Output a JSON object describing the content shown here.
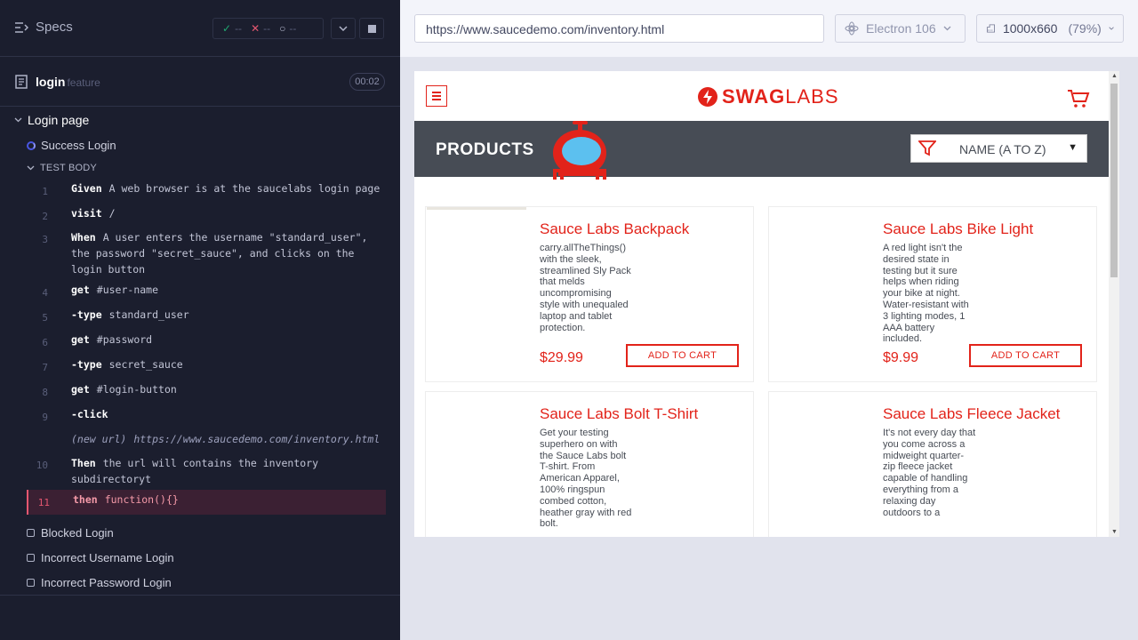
{
  "reporter": {
    "specs_label": "Specs",
    "stats": {
      "passed": "--",
      "failed": "--",
      "pending": "--"
    },
    "spec": {
      "name": "login",
      "kind": "feature",
      "duration": "00:02"
    },
    "suite": "Login page",
    "active_test": "Success Login",
    "test_body_label": "TEST BODY",
    "commands": [
      {
        "num": "1",
        "lines": 1,
        "kw": "Given",
        "arg": "A web browser is at the saucelabs login page"
      },
      {
        "num": "2",
        "lines": 1,
        "kw": "visit",
        "arg": "/"
      },
      {
        "num": "3",
        "lines": 3,
        "kw": "When",
        "arg": "A user enters the username \"standard_user\", the password \"secret_sauce\", and clicks on the login button"
      },
      {
        "num": "4",
        "lines": 1,
        "kw": "get",
        "arg": "#user-name"
      },
      {
        "num": "5",
        "lines": 1,
        "kw": "-type",
        "arg": "standard_user"
      },
      {
        "num": "6",
        "lines": 1,
        "kw": "get",
        "arg": "#password"
      },
      {
        "num": "7",
        "lines": 1,
        "kw": "-type",
        "arg": "secret_sauce"
      },
      {
        "num": "8",
        "lines": 1,
        "kw": "get",
        "arg": "#login-button"
      },
      {
        "num": "9",
        "lines": 1,
        "kw": "-click",
        "arg": ""
      },
      {
        "num": "",
        "lines": 1,
        "kw": "(new url)",
        "arg": "https://www.saucedemo.com/inventory.html",
        "italic": true
      },
      {
        "num": "10",
        "lines": 2,
        "kw": "Then",
        "arg": "the url will contains the inventory subdirectoryt"
      },
      {
        "num": "11",
        "lines": 1,
        "kw": "then",
        "arg": "function(){}",
        "failed": true
      }
    ],
    "pending_tests": [
      "Blocked Login",
      "Incorrect Username Login",
      "Incorrect Password Login"
    ]
  },
  "aut": {
    "url": "https://www.saucedemo.com/inventory.html",
    "browser": "Electron 106",
    "viewport": "1000x660",
    "scale": "(79%)"
  },
  "store": {
    "logo_bold": "SWAG",
    "logo_light": "LABS",
    "page_title": "PRODUCTS",
    "sort_value": "NAME (A TO Z)",
    "add_label": "ADD TO CART",
    "products": [
      {
        "name": "Sauce Labs Backpack",
        "desc": "carry.allTheThings() with the sleek, streamlined Sly Pack that melds uncompromising style with unequaled laptop and tablet protection.",
        "price": "$29.99"
      },
      {
        "name": "Sauce Labs Bike Light",
        "desc": "A red light isn't the desired state in testing but it sure helps when riding your bike at night. Water-resistant with 3 lighting modes, 1 AAA battery included.",
        "price": "$9.99"
      },
      {
        "name": "Sauce Labs Bolt T-Shirt",
        "desc": "Get your testing superhero on with the Sauce Labs bolt T-shirt. From American Apparel, 100% ringspun combed cotton, heather gray with red bolt.",
        "price": ""
      },
      {
        "name": "Sauce Labs Fleece Jacket",
        "desc": "It's not every day that you come across a midweight quarter-zip fleece jacket capable of handling everything from a relaxing day outdoors to a",
        "price": ""
      }
    ]
  },
  "colors": {
    "brand_red": "#e2231a",
    "reporter_bg": "#1b1e2e",
    "fail_red": "#e45770",
    "pass_green": "#1fa971"
  }
}
